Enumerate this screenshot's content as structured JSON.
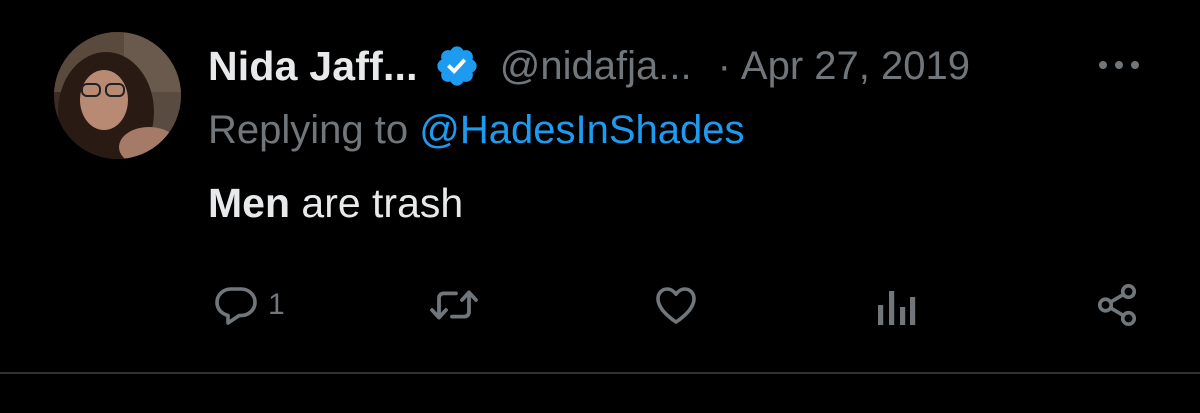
{
  "tweet": {
    "author_name": "Nida Jaff...",
    "handle": "@nidafja...",
    "separator": "·",
    "date": "Apr 27, 2019",
    "replying_prefix": "Replying to ",
    "replying_to": "@HadesInShades",
    "text_bold": "Men",
    "text_rest": " are trash"
  },
  "actions": {
    "reply_count": "1"
  },
  "icons": {
    "verified": "verified-badge-icon",
    "more": "more-dots-icon",
    "reply": "reply-bubble-icon",
    "retweet": "retweet-icon",
    "like": "heart-icon",
    "views": "views-bars-icon",
    "share": "share-icon"
  },
  "colors": {
    "background": "#000000",
    "primary_text": "#e7e9ea",
    "secondary_text": "#71767b",
    "link": "#1d9bf0",
    "verified": "#1d9bf0",
    "divider": "#2f3336"
  }
}
